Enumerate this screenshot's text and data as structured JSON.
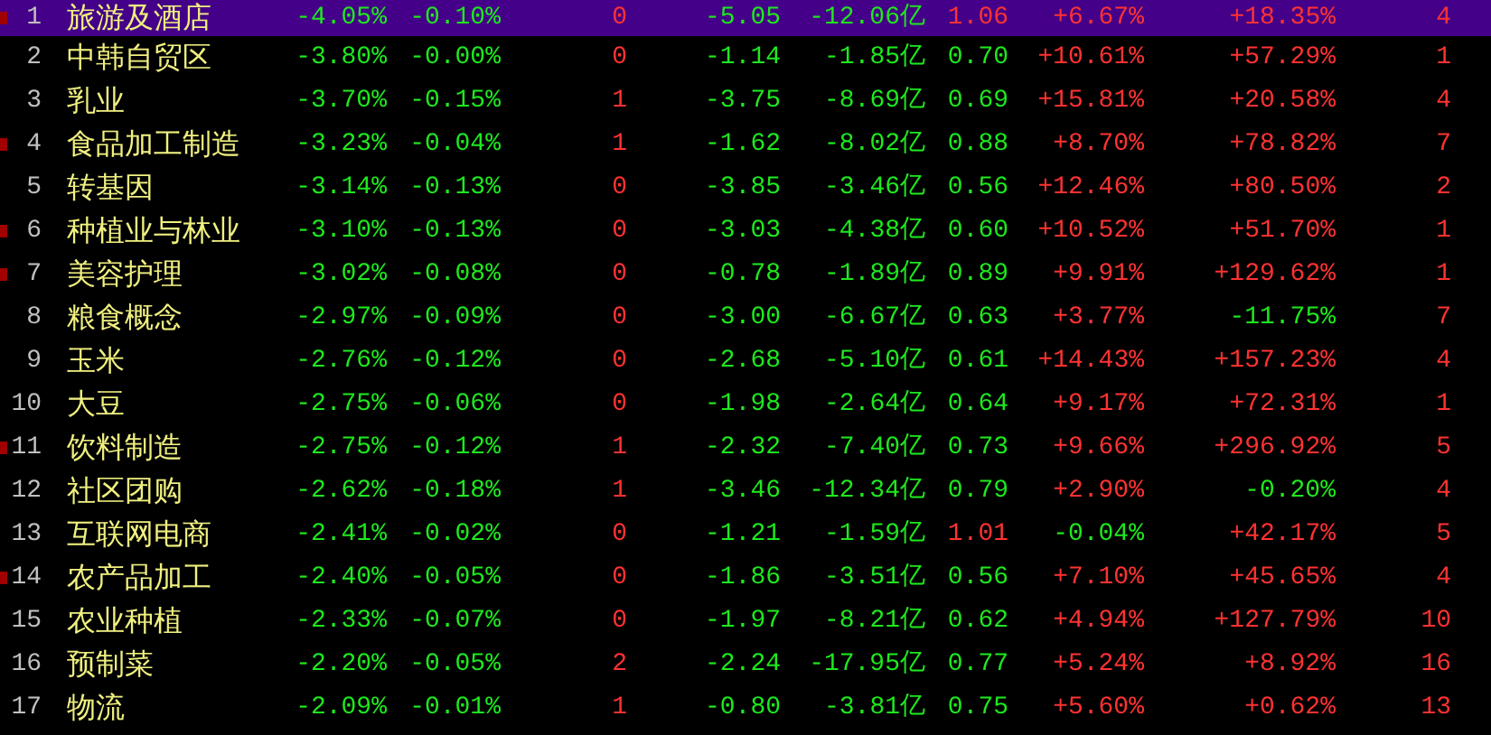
{
  "rows": [
    {
      "rank": "1",
      "name": "旅游及酒店",
      "selected": true,
      "flagged": true,
      "cells": [
        {
          "text": "-4.05%",
          "up": false
        },
        {
          "text": "-0.10%",
          "up": false
        },
        {
          "text": "0",
          "up": true
        },
        {
          "text": "-5.05",
          "up": false
        },
        {
          "text": "-12.06亿",
          "up": false
        },
        {
          "text": "1.06",
          "up": true
        },
        {
          "text": "+6.67%",
          "up": true
        },
        {
          "text": "+18.35%",
          "up": true
        },
        {
          "text": "4",
          "up": true
        }
      ]
    },
    {
      "rank": "2",
      "name": "中韩自贸区",
      "selected": false,
      "flagged": false,
      "cells": [
        {
          "text": "-3.80%",
          "up": false
        },
        {
          "text": "-0.00%",
          "up": false
        },
        {
          "text": "0",
          "up": true
        },
        {
          "text": "-1.14",
          "up": false
        },
        {
          "text": "-1.85亿",
          "up": false
        },
        {
          "text": "0.70",
          "up": false
        },
        {
          "text": "+10.61%",
          "up": true
        },
        {
          "text": "+57.29%",
          "up": true
        },
        {
          "text": "1",
          "up": true
        }
      ]
    },
    {
      "rank": "3",
      "name": "乳业",
      "selected": false,
      "flagged": false,
      "cells": [
        {
          "text": "-3.70%",
          "up": false
        },
        {
          "text": "-0.15%",
          "up": false
        },
        {
          "text": "1",
          "up": true
        },
        {
          "text": "-3.75",
          "up": false
        },
        {
          "text": "-8.69亿",
          "up": false
        },
        {
          "text": "0.69",
          "up": false
        },
        {
          "text": "+15.81%",
          "up": true
        },
        {
          "text": "+20.58%",
          "up": true
        },
        {
          "text": "4",
          "up": true
        }
      ]
    },
    {
      "rank": "4",
      "name": "食品加工制造",
      "selected": false,
      "flagged": true,
      "cells": [
        {
          "text": "-3.23%",
          "up": false
        },
        {
          "text": "-0.04%",
          "up": false
        },
        {
          "text": "1",
          "up": true
        },
        {
          "text": "-1.62",
          "up": false
        },
        {
          "text": "-8.02亿",
          "up": false
        },
        {
          "text": "0.88",
          "up": false
        },
        {
          "text": "+8.70%",
          "up": true
        },
        {
          "text": "+78.82%",
          "up": true
        },
        {
          "text": "7",
          "up": true
        }
      ]
    },
    {
      "rank": "5",
      "name": "转基因",
      "selected": false,
      "flagged": false,
      "cells": [
        {
          "text": "-3.14%",
          "up": false
        },
        {
          "text": "-0.13%",
          "up": false
        },
        {
          "text": "0",
          "up": true
        },
        {
          "text": "-3.85",
          "up": false
        },
        {
          "text": "-3.46亿",
          "up": false
        },
        {
          "text": "0.56",
          "up": false
        },
        {
          "text": "+12.46%",
          "up": true
        },
        {
          "text": "+80.50%",
          "up": true
        },
        {
          "text": "2",
          "up": true
        }
      ]
    },
    {
      "rank": "6",
      "name": "种植业与林业",
      "selected": false,
      "flagged": true,
      "cells": [
        {
          "text": "-3.10%",
          "up": false
        },
        {
          "text": "-0.13%",
          "up": false
        },
        {
          "text": "0",
          "up": true
        },
        {
          "text": "-3.03",
          "up": false
        },
        {
          "text": "-4.38亿",
          "up": false
        },
        {
          "text": "0.60",
          "up": false
        },
        {
          "text": "+10.52%",
          "up": true
        },
        {
          "text": "+51.70%",
          "up": true
        },
        {
          "text": "1",
          "up": true
        }
      ]
    },
    {
      "rank": "7",
      "name": "美容护理",
      "selected": false,
      "flagged": true,
      "cells": [
        {
          "text": "-3.02%",
          "up": false
        },
        {
          "text": "-0.08%",
          "up": false
        },
        {
          "text": "0",
          "up": true
        },
        {
          "text": "-0.78",
          "up": false
        },
        {
          "text": "-1.89亿",
          "up": false
        },
        {
          "text": "0.89",
          "up": false
        },
        {
          "text": "+9.91%",
          "up": true
        },
        {
          "text": "+129.62%",
          "up": true
        },
        {
          "text": "1",
          "up": true
        }
      ]
    },
    {
      "rank": "8",
      "name": "粮食概念",
      "selected": false,
      "flagged": false,
      "cells": [
        {
          "text": "-2.97%",
          "up": false
        },
        {
          "text": "-0.09%",
          "up": false
        },
        {
          "text": "0",
          "up": true
        },
        {
          "text": "-3.00",
          "up": false
        },
        {
          "text": "-6.67亿",
          "up": false
        },
        {
          "text": "0.63",
          "up": false
        },
        {
          "text": "+3.77%",
          "up": true
        },
        {
          "text": "-11.75%",
          "up": false
        },
        {
          "text": "7",
          "up": true
        }
      ]
    },
    {
      "rank": "9",
      "name": "玉米",
      "selected": false,
      "flagged": false,
      "cells": [
        {
          "text": "-2.76%",
          "up": false
        },
        {
          "text": "-0.12%",
          "up": false
        },
        {
          "text": "0",
          "up": true
        },
        {
          "text": "-2.68",
          "up": false
        },
        {
          "text": "-5.10亿",
          "up": false
        },
        {
          "text": "0.61",
          "up": false
        },
        {
          "text": "+14.43%",
          "up": true
        },
        {
          "text": "+157.23%",
          "up": true
        },
        {
          "text": "4",
          "up": true
        }
      ]
    },
    {
      "rank": "10",
      "name": "大豆",
      "selected": false,
      "flagged": false,
      "cells": [
        {
          "text": "-2.75%",
          "up": false
        },
        {
          "text": "-0.06%",
          "up": false
        },
        {
          "text": "0",
          "up": true
        },
        {
          "text": "-1.98",
          "up": false
        },
        {
          "text": "-2.64亿",
          "up": false
        },
        {
          "text": "0.64",
          "up": false
        },
        {
          "text": "+9.17%",
          "up": true
        },
        {
          "text": "+72.31%",
          "up": true
        },
        {
          "text": "1",
          "up": true
        }
      ]
    },
    {
      "rank": "11",
      "name": "饮料制造",
      "selected": false,
      "flagged": true,
      "cells": [
        {
          "text": "-2.75%",
          "up": false
        },
        {
          "text": "-0.12%",
          "up": false
        },
        {
          "text": "1",
          "up": true
        },
        {
          "text": "-2.32",
          "up": false
        },
        {
          "text": "-7.40亿",
          "up": false
        },
        {
          "text": "0.73",
          "up": false
        },
        {
          "text": "+9.66%",
          "up": true
        },
        {
          "text": "+296.92%",
          "up": true
        },
        {
          "text": "5",
          "up": true
        }
      ]
    },
    {
      "rank": "12",
      "name": "社区团购",
      "selected": false,
      "flagged": false,
      "cells": [
        {
          "text": "-2.62%",
          "up": false
        },
        {
          "text": "-0.18%",
          "up": false
        },
        {
          "text": "1",
          "up": true
        },
        {
          "text": "-3.46",
          "up": false
        },
        {
          "text": "-12.34亿",
          "up": false
        },
        {
          "text": "0.79",
          "up": false
        },
        {
          "text": "+2.90%",
          "up": true
        },
        {
          "text": "-0.20%",
          "up": false
        },
        {
          "text": "4",
          "up": true
        }
      ]
    },
    {
      "rank": "13",
      "name": "互联网电商",
      "selected": false,
      "flagged": false,
      "cells": [
        {
          "text": "-2.41%",
          "up": false
        },
        {
          "text": "-0.02%",
          "up": false
        },
        {
          "text": "0",
          "up": true
        },
        {
          "text": "-1.21",
          "up": false
        },
        {
          "text": "-1.59亿",
          "up": false
        },
        {
          "text": "1.01",
          "up": true
        },
        {
          "text": "-0.04%",
          "up": false
        },
        {
          "text": "+42.17%",
          "up": true
        },
        {
          "text": "5",
          "up": true
        }
      ]
    },
    {
      "rank": "14",
      "name": "农产品加工",
      "selected": false,
      "flagged": true,
      "cells": [
        {
          "text": "-2.40%",
          "up": false
        },
        {
          "text": "-0.05%",
          "up": false
        },
        {
          "text": "0",
          "up": true
        },
        {
          "text": "-1.86",
          "up": false
        },
        {
          "text": "-3.51亿",
          "up": false
        },
        {
          "text": "0.56",
          "up": false
        },
        {
          "text": "+7.10%",
          "up": true
        },
        {
          "text": "+45.65%",
          "up": true
        },
        {
          "text": "4",
          "up": true
        }
      ]
    },
    {
      "rank": "15",
      "name": "农业种植",
      "selected": false,
      "flagged": false,
      "cells": [
        {
          "text": "-2.33%",
          "up": false
        },
        {
          "text": "-0.07%",
          "up": false
        },
        {
          "text": "0",
          "up": true
        },
        {
          "text": "-1.97",
          "up": false
        },
        {
          "text": "-8.21亿",
          "up": false
        },
        {
          "text": "0.62",
          "up": false
        },
        {
          "text": "+4.94%",
          "up": true
        },
        {
          "text": "+127.79%",
          "up": true
        },
        {
          "text": "10",
          "up": true
        }
      ]
    },
    {
      "rank": "16",
      "name": "预制菜",
      "selected": false,
      "flagged": false,
      "cells": [
        {
          "text": "-2.20%",
          "up": false
        },
        {
          "text": "-0.05%",
          "up": false
        },
        {
          "text": "2",
          "up": true
        },
        {
          "text": "-2.24",
          "up": false
        },
        {
          "text": "-17.95亿",
          "up": false
        },
        {
          "text": "0.77",
          "up": false
        },
        {
          "text": "+5.24%",
          "up": true
        },
        {
          "text": "+8.92%",
          "up": true
        },
        {
          "text": "16",
          "up": true
        }
      ]
    },
    {
      "rank": "17",
      "name": "物流",
      "selected": false,
      "flagged": false,
      "cells": [
        {
          "text": "-2.09%",
          "up": false
        },
        {
          "text": "-0.01%",
          "up": false
        },
        {
          "text": "1",
          "up": true
        },
        {
          "text": "-0.80",
          "up": false
        },
        {
          "text": "-3.81亿",
          "up": false
        },
        {
          "text": "0.75",
          "up": false
        },
        {
          "text": "+5.60%",
          "up": true
        },
        {
          "text": "+0.62%",
          "up": true
        },
        {
          "text": "13",
          "up": true
        }
      ]
    }
  ]
}
